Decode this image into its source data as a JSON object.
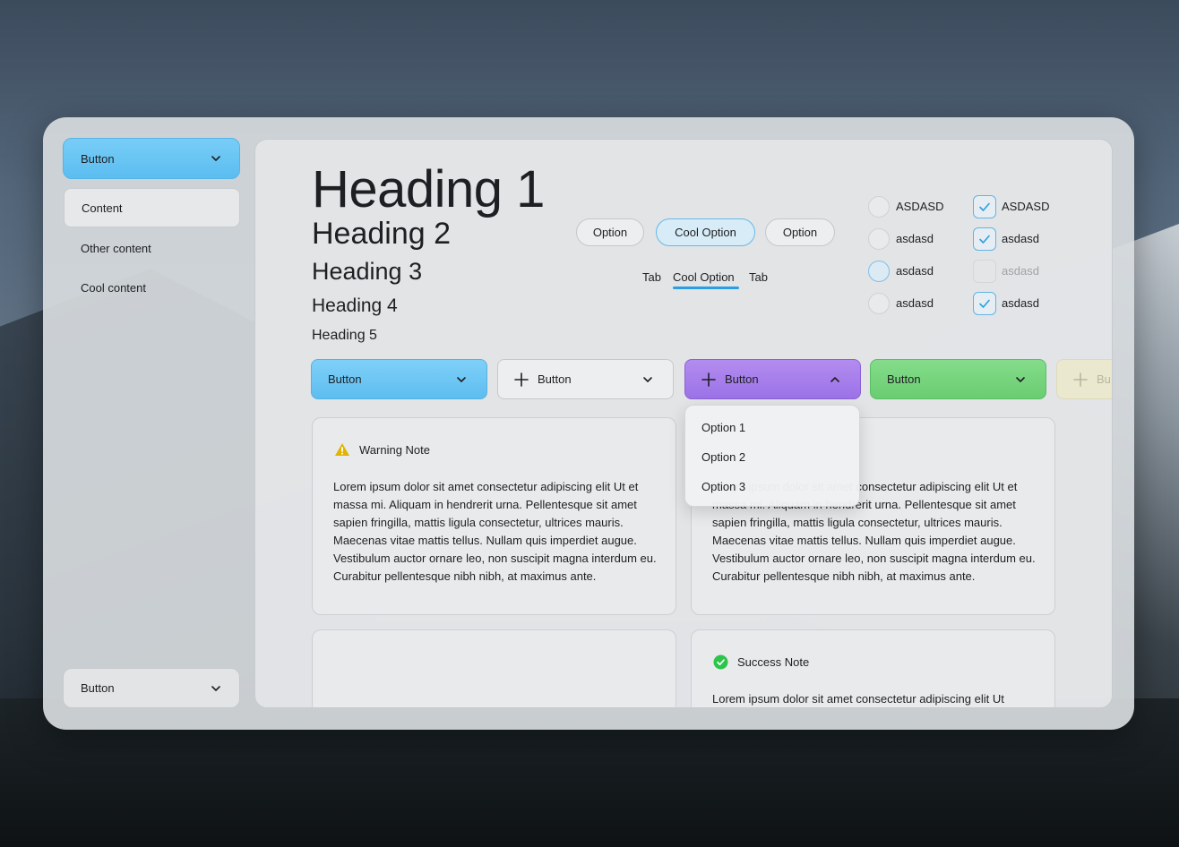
{
  "sidebar": {
    "top_button_label": "Button",
    "items": [
      {
        "label": "Content"
      },
      {
        "label": "Other content"
      },
      {
        "label": "Cool content"
      }
    ],
    "bottom_button_label": "Button"
  },
  "headings": {
    "h1": "Heading 1",
    "h2": "Heading 2",
    "h3": "Heading 3",
    "h4": "Heading 4",
    "h5": "Heading 5"
  },
  "chips": [
    {
      "label": "Option",
      "selected": false
    },
    {
      "label": "Cool Option",
      "selected": true
    },
    {
      "label": "Option",
      "selected": false
    }
  ],
  "tabs": [
    {
      "label": "Tab",
      "active": false
    },
    {
      "label": "Cool Option",
      "active": true
    },
    {
      "label": "Tab",
      "active": false
    }
  ],
  "radios": [
    {
      "label": "ASDASD"
    },
    {
      "label": "asdasd"
    },
    {
      "label": "asdasd",
      "focused": true
    },
    {
      "label": "asdasd"
    }
  ],
  "checkboxes": [
    {
      "label": "ASDASD",
      "checked": true
    },
    {
      "label": "asdasd",
      "checked": true
    },
    {
      "label": "asdasd",
      "checked": false,
      "disabled": true
    },
    {
      "label": "asdasd",
      "checked": true
    }
  ],
  "dropdowns": [
    {
      "label": "Button",
      "color": "#5dbdf0"
    },
    {
      "label": "Button",
      "color": "#eceef0"
    },
    {
      "label": "Button",
      "color": "#9c72e6",
      "open": true
    },
    {
      "label": "Button",
      "color": "#6acd72"
    },
    {
      "label": "Bu",
      "color": "#eae8cf"
    }
  ],
  "dropdown_menu": {
    "options": [
      "Option 1",
      "Option 2",
      "Option 3"
    ]
  },
  "cards": [
    {
      "title": "Warning Note",
      "body": "Lorem ipsum dolor sit amet consectetur adipiscing elit Ut et massa mi. Aliquam in hendrerit urna. Pellentesque sit amet sapien fringilla, mattis ligula consectetur, ultrices mauris. Maecenas vitae mattis tellus. Nullam quis imperdiet augue. Vestibulum auctor ornare leo, non suscipit magna interdum eu. Curabitur pellentesque nibh nibh, at maximus ante."
    },
    {
      "title": "",
      "body": "Lorem ipsum dolor sit amet consectetur adipiscing elit Ut et massa mi. Aliquam in hendrerit urna. Pellentesque sit amet sapien fringilla, mattis ligula consectetur, ultrices mauris. Maecenas vitae mattis tellus. Nullam quis imperdiet augue. Vestibulum auctor ornare leo, non suscipit magna interdum eu. Curabitur pellentesque nibh nibh, at maximus ante."
    },
    {
      "title": "",
      "body": ""
    },
    {
      "title": "Success Note",
      "body": "Lorem ipsum dolor sit amet consectetur adipiscing elit Ut"
    }
  ],
  "colors": {
    "accent_blue": "#5dbdf0",
    "accent_purple": "#9c72e6",
    "accent_green": "#6acd72",
    "warning": "#e0b400",
    "success": "#2cc44a"
  }
}
